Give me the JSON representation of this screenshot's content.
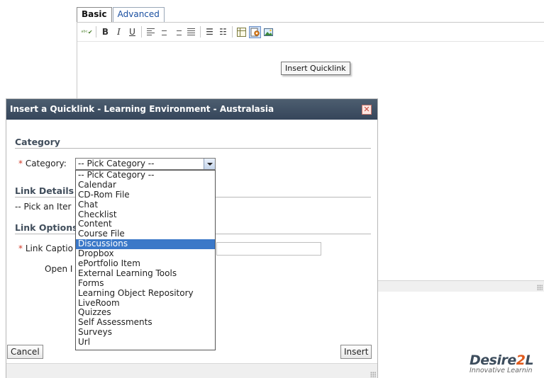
{
  "editor": {
    "tabs": [
      {
        "label": "Basic",
        "active": true
      },
      {
        "label": "Advanced",
        "active": false
      }
    ],
    "toolbar": {
      "spellcheck_glyph": "ᵃᵇᶜ✔",
      "bold_glyph": "B",
      "italic_glyph": "I",
      "underline_glyph": "U",
      "bullet_list_glyph": "☰",
      "number_list_glyph": "☷",
      "icons": [
        "spellcheck-icon",
        "bold-icon",
        "italic-icon",
        "underline-icon",
        "align-left-icon",
        "align-center-icon",
        "align-right-icon",
        "justify-icon",
        "bullet-list-icon",
        "number-list-icon",
        "table-icon",
        "quicklink-icon",
        "image-icon"
      ]
    },
    "tooltip": "Insert Quicklink"
  },
  "logo": {
    "main_a": "Desire",
    "main_b": "2",
    "main_c": "L",
    "tagline": "Innovative Learnin"
  },
  "dialog": {
    "title": "Insert a Quicklink - Learning Environment - Australasia",
    "close_glyph": "✕",
    "category_section": "Category",
    "category_required": "*",
    "category_label": "Category:",
    "category_selected": "-- Pick Category --",
    "options": [
      "-- Pick Category --",
      "Calendar",
      "CD-Rom File",
      "Chat",
      "Checklist",
      "Content",
      "Course File",
      "Discussions",
      "Dropbox",
      "ePortfolio Item",
      "External Learning Tools",
      "Forms",
      "Learning Object Repository",
      "LiveRoom",
      "Quizzes",
      "Self Assessments",
      "Surveys",
      "Url"
    ],
    "highlighted_option": "Discussions",
    "link_details_section": "Link Details",
    "pick_item_text": "-- Pick an Iter",
    "link_options_section": "Link Options",
    "caption_required": "*",
    "link_caption_label": "Link Captio",
    "open_label": "Open I",
    "cancel_label": "Cancel",
    "insert_label": "Insert"
  },
  "colors": {
    "title_bar": "#3f4f63",
    "highlight": "#3b78c8",
    "required": "#d23a28",
    "logo_accent": "#e05a1c"
  }
}
